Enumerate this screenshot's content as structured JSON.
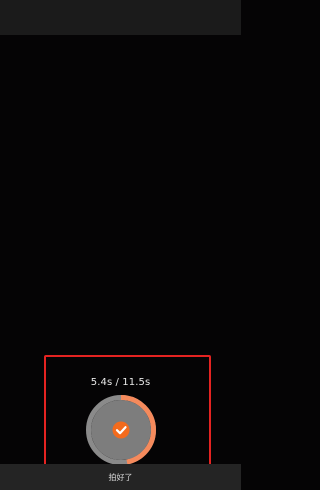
{
  "recording": {
    "elapsed_seconds": 5.4,
    "total_seconds": 11.5,
    "timer_text": "5.4s / 11.5s",
    "progress_fraction": 0.47
  },
  "record_button": {
    "icon": "checkmark-icon",
    "accent_color": "#f36b1d",
    "progress_color": "#f58a5c",
    "ring_track_color": "#8a8a8a",
    "inner_color": "#7d7d7d"
  },
  "bottom_bar": {
    "label": "拍好了"
  },
  "highlight": {
    "color": "#e52321"
  }
}
